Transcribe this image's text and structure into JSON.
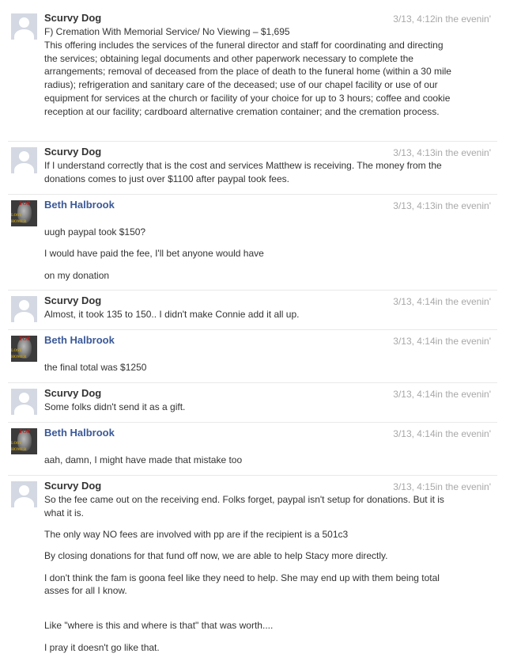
{
  "messages": [
    {
      "author": "Scurvy Dog",
      "time": "3/13, 4:12in the evenin'",
      "avatar": "default-avatar",
      "paragraphs": [
        "F) Cremation With Memorial Service/ No Viewing – $1,695",
        "This offering includes the services of the funeral director and staff for coordinating and directing the services; obtaining legal documents and other paperwork necessary to complete the arrangements; removal of deceased from the place of death to the funeral home (within a 30 mile radius); refrigeration and sanitary care of the deceased; use of our chapel facility or use of our equipment for services at the church or facility of your choice for up to 3 hours; coffee and cookie reception at our facility; cardboard alternative cremation container; and the cremation process."
      ]
    },
    {
      "author": "Scurvy Dog",
      "time": "3/13, 4:13in the evenin'",
      "avatar": "default-avatar",
      "paragraphs": [
        "If I understand correctly that is the cost and services Matthew is receiving. The money from the donations comes to just over $1100 after paypal took fees."
      ]
    },
    {
      "author": "Beth Halbrook",
      "time": "3/13, 4:13in the evenin'",
      "avatar": "photo-avatar",
      "paragraphs": [
        "uugh paypal took $150?",
        "I would have paid the fee, I'll bet anyone would have",
        "on my donation"
      ]
    },
    {
      "author": "Scurvy Dog",
      "time": "3/13, 4:14in the evenin'",
      "avatar": "default-avatar",
      "paragraphs": [
        "Almost, it took 135 to 150.. I didn't make Connie add it all up."
      ]
    },
    {
      "author": "Beth Halbrook",
      "time": "3/13, 4:14in the evenin'",
      "avatar": "photo-avatar",
      "paragraphs": [
        "the final total was $1250"
      ]
    },
    {
      "author": "Scurvy Dog",
      "time": "3/13, 4:14in the evenin'",
      "avatar": "default-avatar",
      "paragraphs": [
        "Some folks didn't send it as a gift."
      ]
    },
    {
      "author": "Beth Halbrook",
      "time": "3/13, 4:14in the evenin'",
      "avatar": "photo-avatar",
      "paragraphs": [
        "aah, damn, I might have made that mistake too"
      ]
    },
    {
      "author": "Scurvy Dog",
      "time": "3/13, 4:15in the evenin'",
      "avatar": "default-avatar",
      "paragraphs": [
        "So the fee came out on the receiving end. Folks forget, paypal isn't setup for donations. But it is what it is.",
        "The only way NO fees are involved with pp are if the recipient is a 501c3",
        "By closing donations for that fund off now, we are able to help Stacy more directly.",
        "I don't think the fam is goona feel like they need to help. She may end up with them being total asses for all I know.",
        "Like \"where is this and where is that\" that was worth....",
        "I pray it doesn't go like that."
      ]
    }
  ],
  "photo_avatar_badge": {
    "top": "TOP",
    "line1": "LOST",
    "line2": "HOMER"
  },
  "colors": {
    "author_default": "#333333",
    "author_link": "#3b5998",
    "timestamp": "#a8a8a8",
    "default_avatar_bg": "#d3d8e2"
  }
}
